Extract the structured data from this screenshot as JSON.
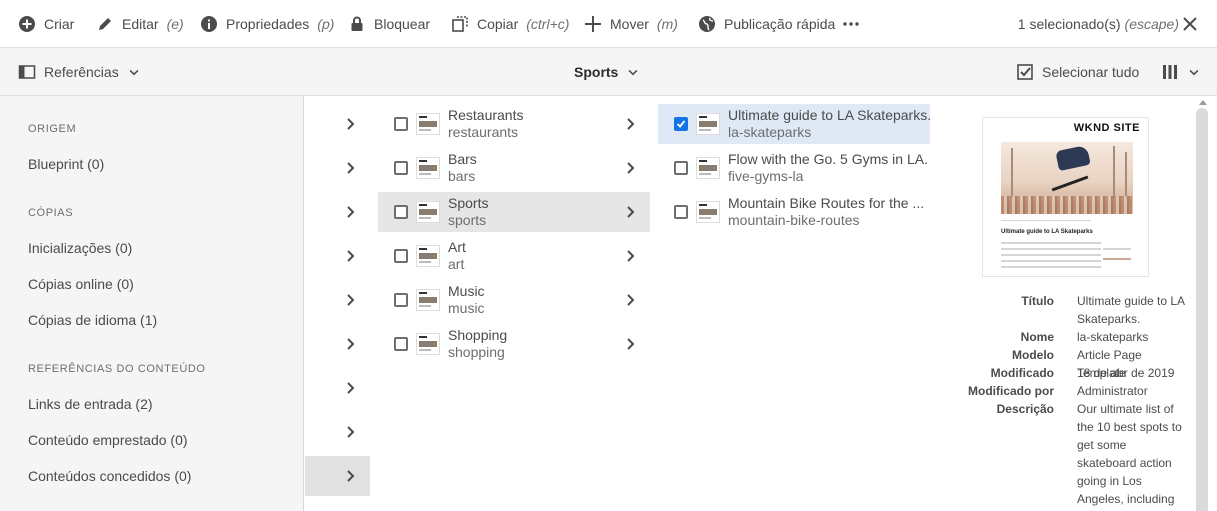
{
  "actionbar": {
    "create": "Criar",
    "edit": "Editar",
    "edit_key": "(e)",
    "properties": "Propriedades",
    "properties_key": "(p)",
    "lock": "Bloquear",
    "copy": "Copiar",
    "copy_key": "(ctrl+c)",
    "move": "Mover",
    "move_key": "(m)",
    "quick_publish": "Publicação rápida",
    "selection": "1 selecionado(s)",
    "selection_key": "(escape)"
  },
  "toolbar": {
    "rail_toggle": "Referências",
    "title": "Sports",
    "select_all": "Selecionar tudo"
  },
  "rail": {
    "sections": [
      {
        "heading": "ORIGEM",
        "items": [
          "Blueprint (0)"
        ]
      },
      {
        "heading": "CÓPIAS",
        "items": [
          "Inicializações (0)",
          "Cópias online (0)",
          "Cópias de idioma (1)"
        ]
      },
      {
        "heading": "REFERÊNCIAS DO CONTEÚDO",
        "items": [
          "Links de entrada (2)",
          "Conteúdo emprestado (0)",
          "Conteúdos concedidos (0)"
        ]
      }
    ]
  },
  "column2": [
    {
      "title": "Restaurants",
      "name": "restaurants"
    },
    {
      "title": "Bars",
      "name": "bars"
    },
    {
      "title": "Sports",
      "name": "sports"
    },
    {
      "title": "Art",
      "name": "art"
    },
    {
      "title": "Music",
      "name": "music"
    },
    {
      "title": "Shopping",
      "name": "shopping"
    }
  ],
  "column3": [
    {
      "title": "Ultimate guide to LA Skateparks.",
      "name": "la-skateparks",
      "checked": true
    },
    {
      "title": "Flow with the Go. 5 Gyms in LA.",
      "name": "five-gyms-la",
      "checked": false
    },
    {
      "title": "Mountain Bike Routes for the ...",
      "name": "mountain-bike-routes",
      "checked": false
    }
  ],
  "preview": {
    "site_logo": "WKND SITE",
    "page_heading": "Ultimate guide to LA Skateparks",
    "meta": [
      {
        "label": "Título",
        "value": "Ultimate guide to LA Skateparks."
      },
      {
        "label": "Nome",
        "value": "la-skateparks"
      },
      {
        "label": "Modelo",
        "value": "Article Page Template"
      },
      {
        "label": "Modificado",
        "value": "18 de abr de 2019"
      },
      {
        "label": "Modificado por",
        "value": "Administrator"
      },
      {
        "label": "Descrição",
        "value": "Our ultimate list of the 10 best spots to get some skateboard action going in Los Angeles, including some spots that you"
      }
    ]
  },
  "colors": {
    "selected_blue": "#dfe9f6",
    "checkbox_blue": "#1473e6",
    "rail_bg": "#f5f5f5"
  }
}
